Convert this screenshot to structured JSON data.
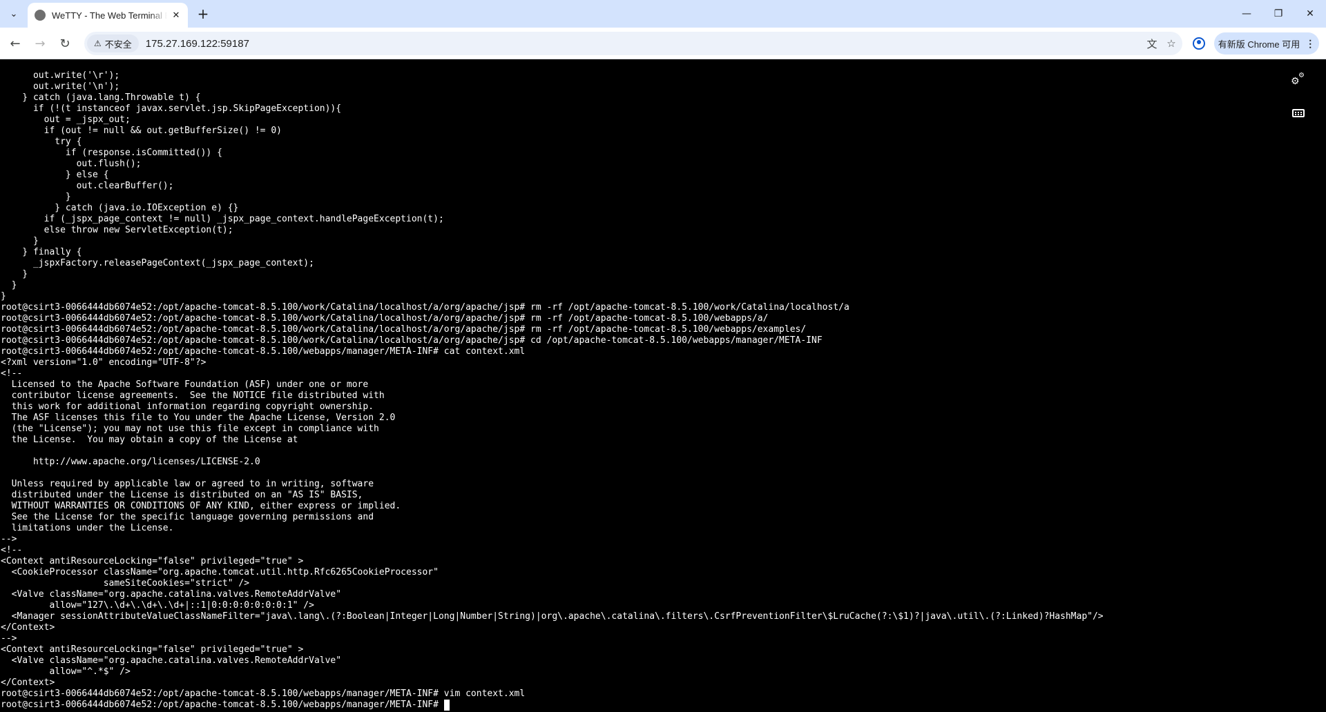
{
  "browser": {
    "tab": {
      "title": "WeTTY - The Web Terminal Emulator"
    },
    "address": {
      "security_label": "不安全",
      "url": "175.27.169.122:59187"
    },
    "update_chip": "有新版 Chrome 可用",
    "icons": {
      "tab_search": "chevron-down-icon",
      "close": "close-icon",
      "new_tab": "plus-icon",
      "back": "back-arrow-icon",
      "forward": "forward-arrow-icon",
      "reload": "reload-icon",
      "translate": "translate-icon",
      "bookmark": "star-icon",
      "profile": "profile-icon",
      "menu": "kebab-icon"
    }
  },
  "terminal": {
    "colors": {
      "background": "#000000",
      "foreground": "#ffffff"
    },
    "lines": [
      "      out.write('\\r');",
      "      out.write('\\n');",
      "    } catch (java.lang.Throwable t) {",
      "      if (!(t instanceof javax.servlet.jsp.SkipPageException)){",
      "        out = _jspx_out;",
      "        if (out != null && out.getBufferSize() != 0)",
      "          try {",
      "            if (response.isCommitted()) {",
      "              out.flush();",
      "            } else {",
      "              out.clearBuffer();",
      "            }",
      "          } catch (java.io.IOException e) {}",
      "        if (_jspx_page_context != null) _jspx_page_context.handlePageException(t);",
      "        else throw new ServletException(t);",
      "      }",
      "    } finally {",
      "      _jspxFactory.releasePageContext(_jspx_page_context);",
      "    }",
      "  }",
      "}",
      "root@csirt3-0066444db6074e52:/opt/apache-tomcat-8.5.100/work/Catalina/localhost/a/org/apache/jsp# rm -rf /opt/apache-tomcat-8.5.100/work/Catalina/localhost/a",
      "root@csirt3-0066444db6074e52:/opt/apache-tomcat-8.5.100/work/Catalina/localhost/a/org/apache/jsp# rm -rf /opt/apache-tomcat-8.5.100/webapps/a/",
      "root@csirt3-0066444db6074e52:/opt/apache-tomcat-8.5.100/work/Catalina/localhost/a/org/apache/jsp# rm -rf /opt/apache-tomcat-8.5.100/webapps/examples/",
      "root@csirt3-0066444db6074e52:/opt/apache-tomcat-8.5.100/work/Catalina/localhost/a/org/apache/jsp# cd /opt/apache-tomcat-8.5.100/webapps/manager/META-INF",
      "root@csirt3-0066444db6074e52:/opt/apache-tomcat-8.5.100/webapps/manager/META-INF# cat context.xml",
      "<?xml version=\"1.0\" encoding=\"UTF-8\"?>",
      "<!--",
      "  Licensed to the Apache Software Foundation (ASF) under one or more",
      "  contributor license agreements.  See the NOTICE file distributed with",
      "  this work for additional information regarding copyright ownership.",
      "  The ASF licenses this file to You under the Apache License, Version 2.0",
      "  (the \"License\"); you may not use this file except in compliance with",
      "  the License.  You may obtain a copy of the License at",
      "",
      "      http://www.apache.org/licenses/LICENSE-2.0",
      "",
      "  Unless required by applicable law or agreed to in writing, software",
      "  distributed under the License is distributed on an \"AS IS\" BASIS,",
      "  WITHOUT WARRANTIES OR CONDITIONS OF ANY KIND, either express or implied.",
      "  See the License for the specific language governing permissions and",
      "  limitations under the License.",
      "-->",
      "<!--",
      "<Context antiResourceLocking=\"false\" privileged=\"true\" >",
      "  <CookieProcessor className=\"org.apache.tomcat.util.http.Rfc6265CookieProcessor\"",
      "                   sameSiteCookies=\"strict\" />",
      "  <Valve className=\"org.apache.catalina.valves.RemoteAddrValve\"",
      "         allow=\"127\\.\\d+\\.\\d+\\.\\d+|::1|0:0:0:0:0:0:0:1\" />",
      "  <Manager sessionAttributeValueClassNameFilter=\"java\\.lang\\.(?:Boolean|Integer|Long|Number|String)|org\\.apache\\.catalina\\.filters\\.CsrfPreventionFilter\\$LruCache(?:\\$1)?|java\\.util\\.(?:Linked)?HashMap\"/>",
      "</Context>",
      "-->",
      "<Context antiResourceLocking=\"false\" privileged=\"true\" >",
      "  <Valve className=\"org.apache.catalina.valves.RemoteAddrValve\"",
      "         allow=\"^.*$\" />",
      "</Context>",
      "root@csirt3-0066444db6074e52:/opt/apache-tomcat-8.5.100/webapps/manager/META-INF# vim context.xml"
    ],
    "prompt": "root@csirt3-0066444db6074e52:/opt/apache-tomcat-8.5.100/webapps/manager/META-INF# ",
    "overlay_icons": {
      "settings": "gears-icon",
      "keyboard": "keyboard-icon"
    }
  }
}
